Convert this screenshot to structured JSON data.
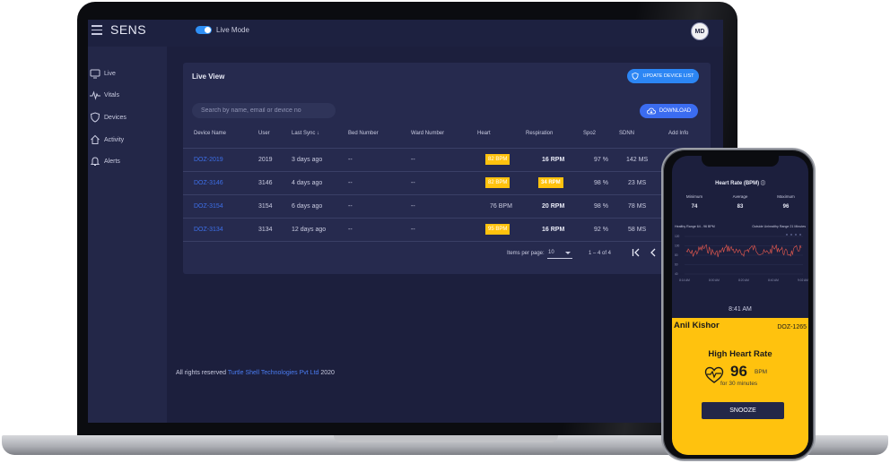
{
  "app": {
    "brand": "SENS",
    "live_mode_label": "Live Mode",
    "avatar_initials": "MD"
  },
  "sidebar": {
    "items": [
      {
        "label": "Live",
        "icon": "monitor-icon"
      },
      {
        "label": "Vitals",
        "icon": "pulse-icon"
      },
      {
        "label": "Devices",
        "icon": "shield-icon"
      },
      {
        "label": "Activity",
        "icon": "home-icon"
      },
      {
        "label": "Alerts",
        "icon": "bell-icon"
      }
    ]
  },
  "panel": {
    "title": "Live View",
    "update_button": "UPDATE DEVICE LIST",
    "search_placeholder": "Search by name, email or device no",
    "download_button": "DOWNLOAD",
    "columns": [
      "Device Name",
      "User",
      "Last Sync",
      "Bed Number",
      "Ward Number",
      "Heart",
      "Respiration",
      "Spo2",
      "SDNN",
      "Add Info"
    ],
    "rows": [
      {
        "device": "DOZ-2019",
        "user": "2019",
        "last_sync": "3 days ago",
        "bed": "--",
        "ward": "--",
        "heart": "82 BPM",
        "heart_alert": true,
        "resp": "16 RPM",
        "resp_alert": false,
        "spo2": "97 %",
        "sdnn": "142 MS"
      },
      {
        "device": "DOZ-3146",
        "user": "3146",
        "last_sync": "4 days ago",
        "bed": "--",
        "ward": "--",
        "heart": "82 BPM",
        "heart_alert": true,
        "resp": "34 RPM",
        "resp_alert": true,
        "spo2": "98 %",
        "sdnn": "23 MS"
      },
      {
        "device": "DOZ-3154",
        "user": "3154",
        "last_sync": "6 days ago",
        "bed": "--",
        "ward": "--",
        "heart": "76 BPM",
        "heart_alert": false,
        "resp": "20 RPM",
        "resp_alert": false,
        "spo2": "98 %",
        "sdnn": "78 MS"
      },
      {
        "device": "DOZ-3134",
        "user": "3134",
        "last_sync": "12 days ago",
        "bed": "--",
        "ward": "--",
        "heart": "95 BPM",
        "heart_alert": true,
        "resp": "16 RPM",
        "resp_alert": false,
        "spo2": "92 %",
        "sdnn": "58 MS"
      }
    ],
    "pager": {
      "label": "Items per page:",
      "per_page": "10",
      "range": "1 – 4 of 4"
    }
  },
  "footer": {
    "prefix": "All rights reserved",
    "company": "Turtle Shell Technologies Pvt Ltd",
    "year": "2020"
  },
  "phone": {
    "title": "Heart Rate (BPM)",
    "stats": [
      {
        "label": "Minimum",
        "value": "74"
      },
      {
        "label": "Average",
        "value": "83"
      },
      {
        "label": "Maximum",
        "value": "96"
      }
    ],
    "healthy_range": "Healthy Range 64 - 96 BPM",
    "outside_range": "Outside Unhealthy Range 21 Minutes",
    "chart_yticks": [
      "120",
      "100",
      "80",
      "60",
      "40"
    ],
    "chart_xticks": [
      "8:14 AM",
      "8:00 AM",
      "8:20 AM",
      "8:40 AM",
      "9:02 AM"
    ],
    "time": "8:41 AM",
    "alert": {
      "name": "Anil Kishor",
      "device": "DOZ-1265",
      "title": "High Heart Rate",
      "value": "96",
      "unit": "BPM",
      "duration": "for 30 minutes",
      "snooze": "SNOOZE"
    }
  },
  "colors": {
    "accent": "#2c86f4",
    "alert": "#ffc20e",
    "background": "#1c1f3d"
  }
}
